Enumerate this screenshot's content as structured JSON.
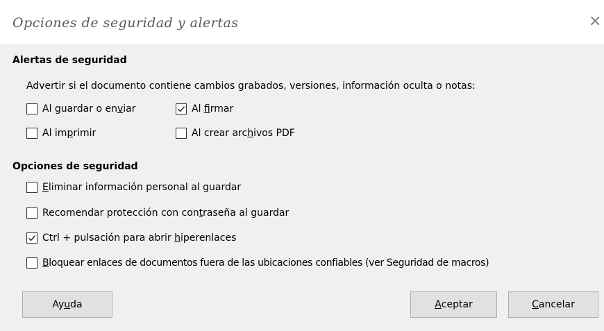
{
  "dialog": {
    "title": "Opciones de seguridad y alertas",
    "close_glyph": "×"
  },
  "alerts": {
    "heading": "Alertas de seguridad",
    "description": "Advertir si el documento contiene cambios grabados, versiones, información oculta o notas:",
    "checkboxes": [
      {
        "pre": "Al guardar o en",
        "key": "v",
        "post": "iar",
        "checked": false
      },
      {
        "pre": "Al ",
        "key": "f",
        "post": "irmar",
        "checked": true
      },
      {
        "pre": "Al im",
        "key": "p",
        "post": "rimir",
        "checked": false
      },
      {
        "pre": "Al crear arc",
        "key": "h",
        "post": "ivos PDF",
        "checked": false
      }
    ]
  },
  "security": {
    "heading": "Opciones de seguridad",
    "checkboxes": [
      {
        "pre": "",
        "key": "E",
        "post": "liminar información personal al guardar",
        "checked": false
      },
      {
        "pre": "Recomendar protección con con",
        "key": "t",
        "post": "raseña al guardar",
        "checked": false
      },
      {
        "pre": "Ctrl + pulsación para abrir ",
        "key": "h",
        "post": "iperenlaces",
        "checked": true
      },
      {
        "pre": "",
        "key": "B",
        "post": "loquear enlaces de documentos fuera de las ubicaciones confiables (ver Seguridad de macros)",
        "checked": false
      }
    ]
  },
  "buttons": {
    "help": {
      "pre": "Ay",
      "key": "u",
      "post": "da"
    },
    "ok": {
      "pre": "",
      "key": "A",
      "post": "ceptar"
    },
    "cancel": {
      "pre": "",
      "key": "C",
      "post": "ancelar"
    }
  }
}
